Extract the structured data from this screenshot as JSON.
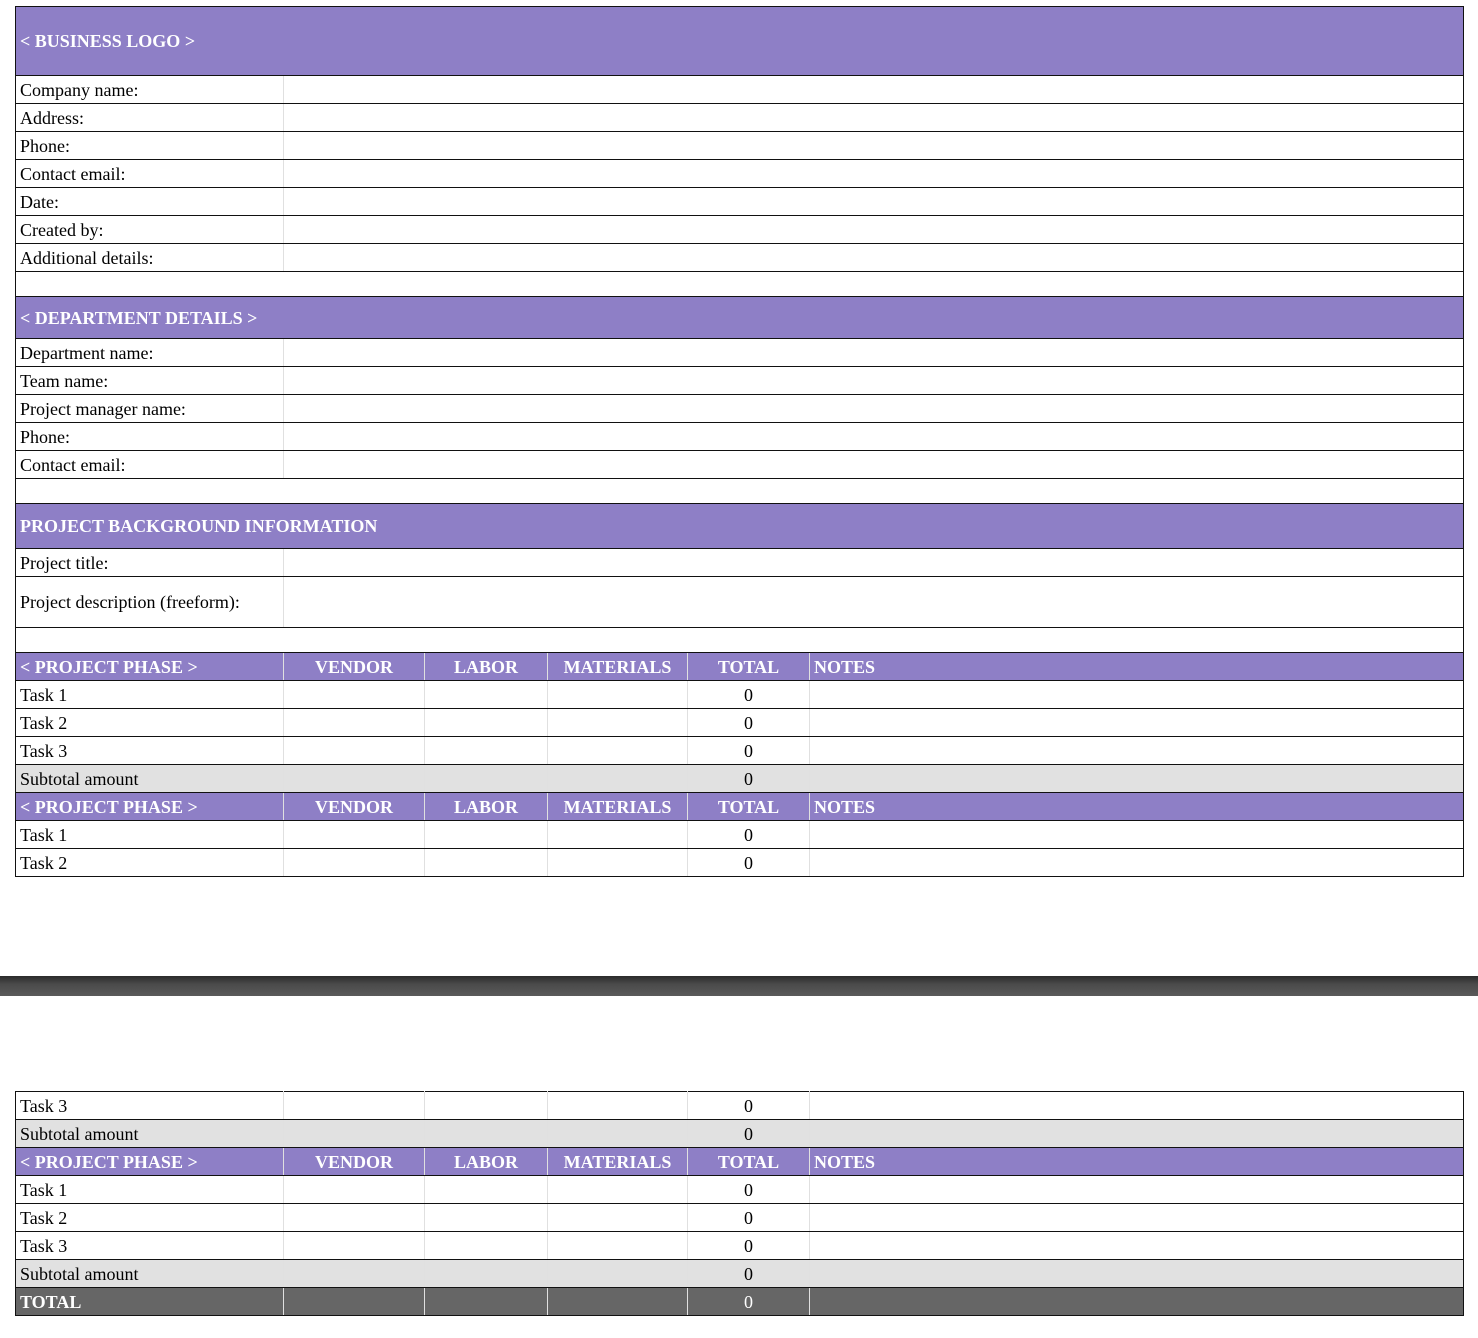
{
  "business_logo": "< BUSINESS LOGO >",
  "company_fields": [
    "Company name:",
    "Address:",
    "Phone:",
    "Contact email:",
    "Date:",
    "Created by:",
    "Additional details:"
  ],
  "department_header": "< DEPARTMENT DETAILS >",
  "department_fields": [
    "Department name:",
    "Team name:",
    "Project manager name:",
    "Phone:",
    "Contact email:"
  ],
  "project_header": "PROJECT BACKGROUND INFORMATION",
  "project_fields": {
    "title": "Project title:",
    "description": "Project description (freeform):"
  },
  "columns": {
    "phase": "< PROJECT PHASE >",
    "vendor": "VENDOR",
    "labor": "LABOR",
    "materials": "MATERIALS",
    "total": "TOTAL",
    "notes": "NOTES"
  },
  "phases": [
    {
      "tasks": [
        {
          "label": "Task 1",
          "total": "0"
        },
        {
          "label": "Task 2",
          "total": "0"
        },
        {
          "label": "Task 3",
          "total": "0"
        }
      ],
      "subtotal_label": "Subtotal amount",
      "subtotal": "0"
    },
    {
      "tasks": [
        {
          "label": "Task 1",
          "total": "0"
        },
        {
          "label": "Task 2",
          "total": "0"
        },
        {
          "label": "Task 3",
          "total": "0"
        }
      ],
      "subtotal_label": "Subtotal amount",
      "subtotal": "0"
    },
    {
      "tasks": [
        {
          "label": "Task 1",
          "total": "0"
        },
        {
          "label": "Task 2",
          "total": "0"
        },
        {
          "label": "Task 3",
          "total": "0"
        }
      ],
      "subtotal_label": "Subtotal amount",
      "subtotal": "0"
    }
  ],
  "grand_total": {
    "label": "TOTAL",
    "value": "0"
  },
  "colors": {
    "header": "#8e7fc6",
    "subtotal": "#e1e1e1",
    "grand_total": "#666666"
  }
}
